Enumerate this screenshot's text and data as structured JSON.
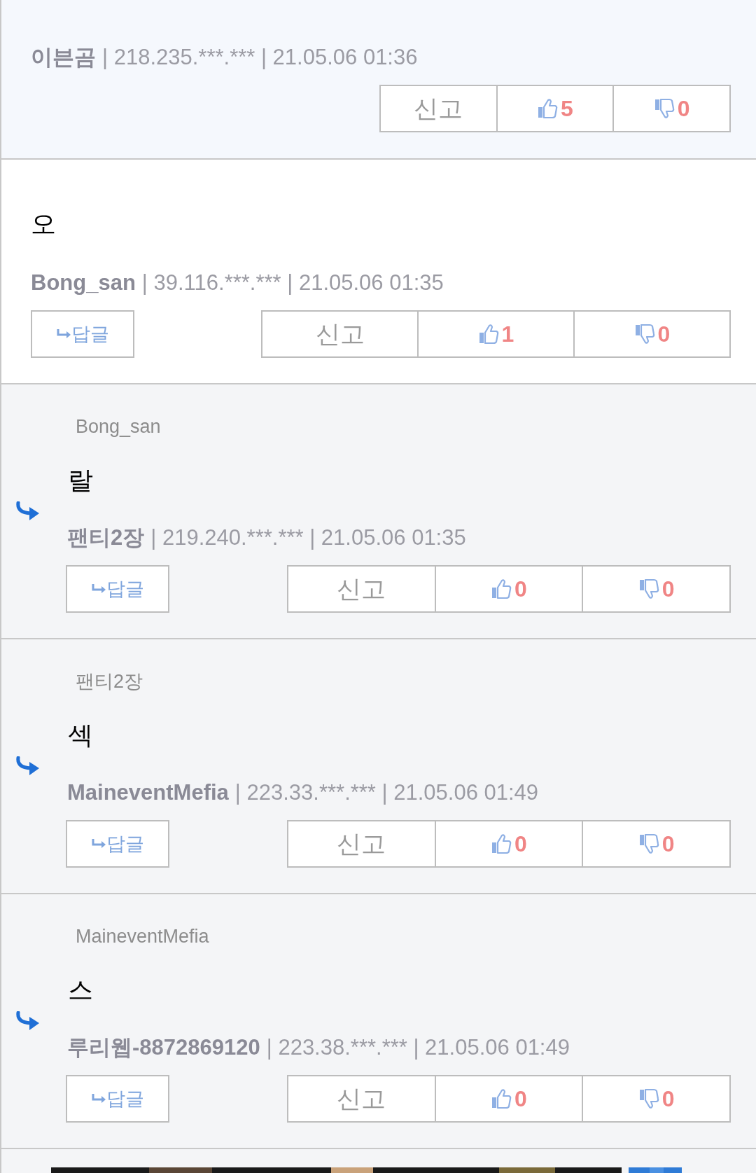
{
  "comments": [
    {
      "kind": "best_comment",
      "author": "이븐곰",
      "info": "| 218.235.***.*** | 21.05.06 01:36",
      "report": "신고",
      "likes": "5",
      "dislikes": "0"
    },
    {
      "kind": "comment",
      "content": "오",
      "author": "Bong_san",
      "info": "| 39.116.***.*** | 21.05.06 01:35",
      "reply": "답글",
      "report": "신고",
      "likes": "1",
      "dislikes": "0"
    },
    {
      "kind": "reply",
      "parent": "Bong_san",
      "content": "랄",
      "author": "팬티2장",
      "info": "| 219.240.***.*** | 21.05.06 01:35",
      "reply": "답글",
      "report": "신고",
      "likes": "0",
      "dislikes": "0"
    },
    {
      "kind": "reply",
      "parent": "팬티2장",
      "content": "섹",
      "author": "MaineventMefia",
      "info": "| 223.33.***.*** | 21.05.06 01:49",
      "reply": "답글",
      "report": "신고",
      "likes": "0",
      "dislikes": "0"
    },
    {
      "kind": "reply",
      "parent": "MaineventMefia",
      "content": "스",
      "author": "루리웹-8872869120",
      "info": "| 223.38.***.*** | 21.05.06 01:49",
      "reply": "답글",
      "report": "신고",
      "likes": "0",
      "dislikes": "0"
    }
  ]
}
